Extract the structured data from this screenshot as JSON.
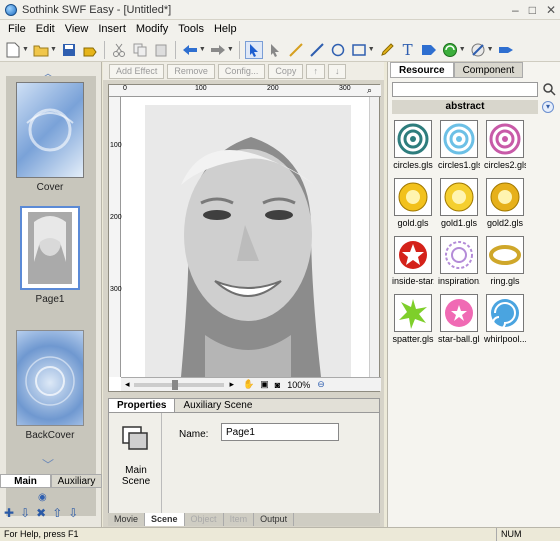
{
  "window": {
    "title": "Sothink SWF Easy - [Untitled*]",
    "min": "–",
    "max": "□",
    "close": "✕"
  },
  "menu": [
    "File",
    "Edit",
    "View",
    "Insert",
    "Modify",
    "Tools",
    "Help"
  ],
  "left": {
    "pages": [
      {
        "label": "Cover"
      },
      {
        "label": "Page1"
      },
      {
        "label": "BackCover"
      }
    ],
    "tabs": {
      "main": "Main",
      "auxiliary": "Auxiliary"
    }
  },
  "effects": {
    "add": "Add Effect",
    "remove": "Remove",
    "config": "Config...",
    "copy": "Copy"
  },
  "canvas": {
    "ruler_h": [
      "0",
      "100",
      "200",
      "300"
    ],
    "ruler_v": [
      "100",
      "200",
      "300"
    ],
    "zoom": "100%"
  },
  "props": {
    "tab_properties": "Properties",
    "tab_aux": "Auxiliary Scene",
    "scene_label": "Main Scene",
    "name_label": "Name:",
    "name_value": "Page1"
  },
  "bottom_tabs": {
    "movie": "Movie",
    "scene": "Scene",
    "object": "Object",
    "item": "Item",
    "output": "Output"
  },
  "resource": {
    "tab_resource": "Resource",
    "tab_component": "Component",
    "category": "abstract",
    "items": [
      {
        "label": "circles.gls",
        "color": "#2e7d7d"
      },
      {
        "label": "circles1.gls",
        "color": "#6cc0e6"
      },
      {
        "label": "circles2.gls",
        "color": "#c85aa8"
      },
      {
        "label": "gold.gls",
        "color": "#f2c11c"
      },
      {
        "label": "gold1.gls",
        "color": "#f5cf2f"
      },
      {
        "label": "gold2.gls",
        "color": "#e6b01a"
      },
      {
        "label": "inside-star...",
        "color": "#d4221a"
      },
      {
        "label": "inspiration...",
        "color": "#b48cd8"
      },
      {
        "label": "ring.gls",
        "color": "#cfa72a"
      },
      {
        "label": "spatter.gls",
        "color": "#7ecf2a"
      },
      {
        "label": "star-ball.gls",
        "color": "#f06ab4"
      },
      {
        "label": "whirlpool....",
        "color": "#4aa4e0"
      }
    ]
  },
  "status": {
    "help": "For Help, press F1",
    "num": "NUM"
  }
}
